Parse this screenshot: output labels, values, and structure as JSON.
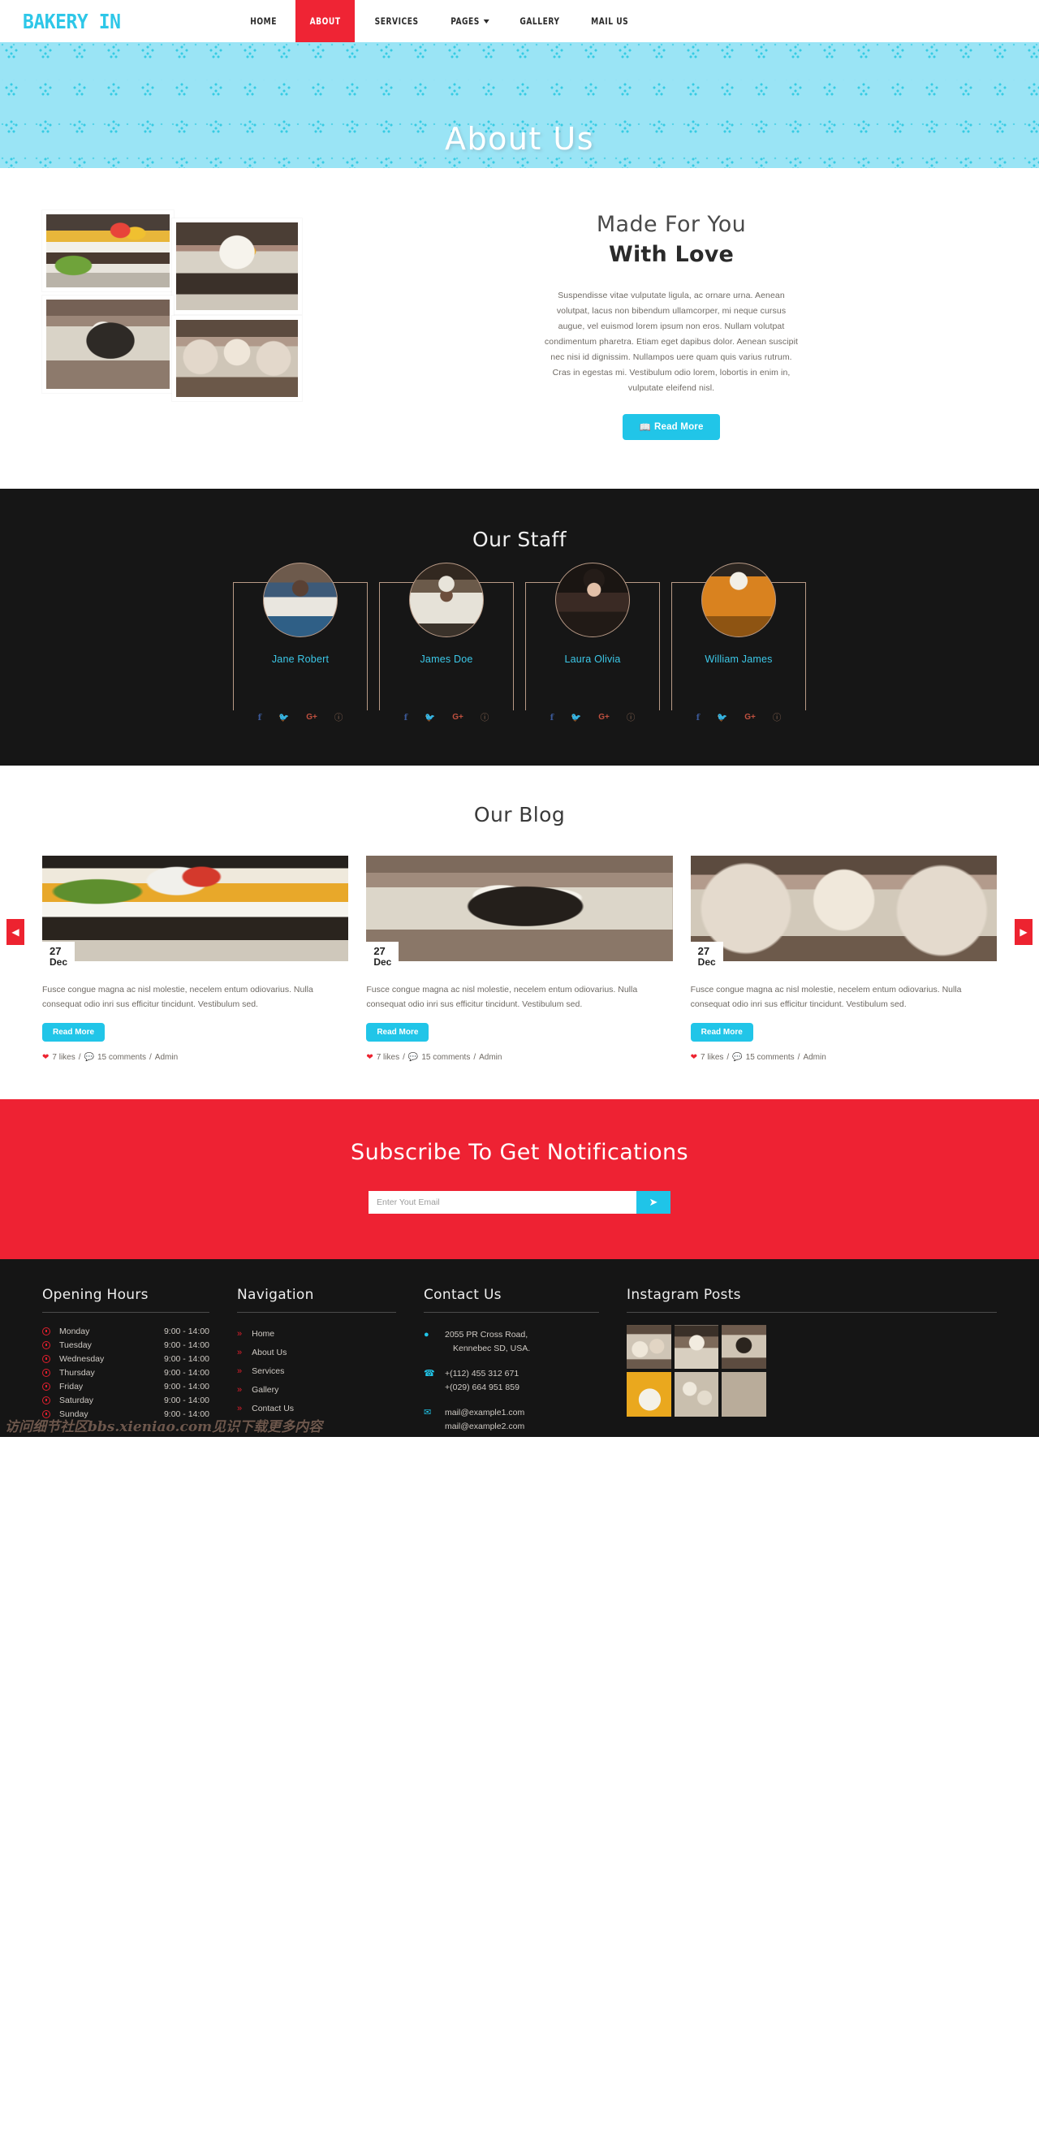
{
  "brand": {
    "text": "BAKERY IN",
    "color": "#2ec7e8"
  },
  "nav": {
    "items": [
      {
        "label": "HOME",
        "active": false
      },
      {
        "label": "ABOUT",
        "active": true
      },
      {
        "label": "SERVICES",
        "active": false
      },
      {
        "label": "PAGES",
        "active": false,
        "has_caret": true
      },
      {
        "label": "GALLERY",
        "active": false
      },
      {
        "label": "MAIL US",
        "active": false
      }
    ],
    "active_color": "#ef2434"
  },
  "hero": {
    "title": "About Us",
    "bg_color": "#9ae4f5",
    "pattern_color": "#25c7e0"
  },
  "about": {
    "heading_line1": "Made For You",
    "heading_line2": "With Love",
    "paragraph": "Suspendisse vitae vulputate ligula, ac ornare urna. Aenean volutpat, lacus non bibendum ullamcorper, mi neque cursus augue, vel euismod lorem ipsum non eros. Nullam volutpat condimentum pharetra. Etiam eget dapibus dolor. Aenean suscipit nec nisi id dignissim. Nullampos uere quam quis varius rutrum. Cras in egestas mi. Vestibulum odio lorem, lobortis in enim in, vulputate eleifend nisl.",
    "button_label": "Read More",
    "button_icon": "book-icon",
    "button_color": "#21c5e8",
    "images": [
      {
        "name": "layered-cake-photo"
      },
      {
        "name": "cupcake-in-cup-photo"
      },
      {
        "name": "dark-cake-with-fork-photo"
      },
      {
        "name": "cupcakes-tray-photo"
      }
    ]
  },
  "staff": {
    "title": "Our Staff",
    "members": [
      {
        "name": "Jane Robert"
      },
      {
        "name": "James Doe"
      },
      {
        "name": "Laura Olivia"
      },
      {
        "name": "William James"
      }
    ],
    "social": [
      {
        "icon": "facebook-icon",
        "glyph": "f",
        "color": "#3b5998"
      },
      {
        "icon": "twitter-icon",
        "glyph": "ᴗ",
        "color": "#35c6e8"
      },
      {
        "icon": "google-plus-icon",
        "glyph": "G+",
        "color": "#c0503f"
      },
      {
        "icon": "dribbble-icon",
        "glyph": "ⓓ",
        "color": "#8d6a56"
      }
    ],
    "name_color": "#3cc8e8",
    "bg_color": "#161616"
  },
  "blog": {
    "title": "Our Blog",
    "prev_label": "◀",
    "next_label": "▶",
    "posts": [
      {
        "day": "27",
        "month": "Dec",
        "text": "Fusce congue magna ac nisl molestie, necelem entum odiovarius. Nulla consequat odio inri sus efficitur tincidunt. Vestibulum sed.",
        "button_label": "Read More",
        "likes": "7 likes",
        "comments": "15 comments",
        "author": "Admin",
        "separator": "/"
      },
      {
        "day": "27",
        "month": "Dec",
        "text": "Fusce congue magna ac nisl molestie, necelem entum odiovarius. Nulla consequat odio inri sus efficitur tincidunt. Vestibulum sed.",
        "button_label": "Read More",
        "likes": "7 likes",
        "comments": "15 comments",
        "author": "Admin",
        "separator": "/"
      },
      {
        "day": "27",
        "month": "Dec",
        "text": "Fusce congue magna ac nisl molestie, necelem entum odiovarius. Nulla consequat odio inri sus efficitur tincidunt. Vestibulum sed.",
        "button_label": "Read More",
        "likes": "7 likes",
        "comments": "15 comments",
        "author": "Admin",
        "separator": "/"
      }
    ]
  },
  "subscribe": {
    "title": "Subscribe To Get Notifications",
    "placeholder": "Enter Yout Email",
    "value": "",
    "submit_icon": "paper-plane-icon",
    "bg_color": "#ee2233",
    "button_color": "#1fc4e8"
  },
  "footer": {
    "hours": {
      "title": "Opening Hours",
      "rows": [
        {
          "day": "Monday",
          "time": "9:00 - 14:00"
        },
        {
          "day": "Tuesday",
          "time": "9:00 - 14:00"
        },
        {
          "day": "Wednesday",
          "time": "9:00 - 14:00"
        },
        {
          "day": "Thursday",
          "time": "9:00 - 14:00"
        },
        {
          "day": "Friday",
          "time": "9:00 - 14:00"
        },
        {
          "day": "Saturday",
          "time": "9:00 - 14:00"
        },
        {
          "day": "Sunday",
          "time": "9:00 - 14:00"
        }
      ]
    },
    "navigation": {
      "title": "Navigation",
      "items": [
        "Home",
        "About Us",
        "Services",
        "Gallery",
        "Contact Us"
      ]
    },
    "contact": {
      "title": "Contact Us",
      "address_line1": "2055 PR Cross Road,",
      "address_line2": "Kennebec SD, USA.",
      "phone1": "+(112) 455 312 671",
      "phone2": "+(029) 664 951 859",
      "email1": "mail@example1.com",
      "email2": "mail@example2.com",
      "icon_color": "#21c5e8"
    },
    "instagram": {
      "title": "Instagram Posts",
      "cells": [
        "cupcakes-post",
        "cupcake-closeup-post",
        "dark-cake-post",
        "yellow-plate-cake-post",
        "muffins-post",
        "bread-rolls-post"
      ]
    }
  },
  "watermark": {
    "text": "访问细节社区bbs.xieniao.com见识下载更多内容"
  }
}
